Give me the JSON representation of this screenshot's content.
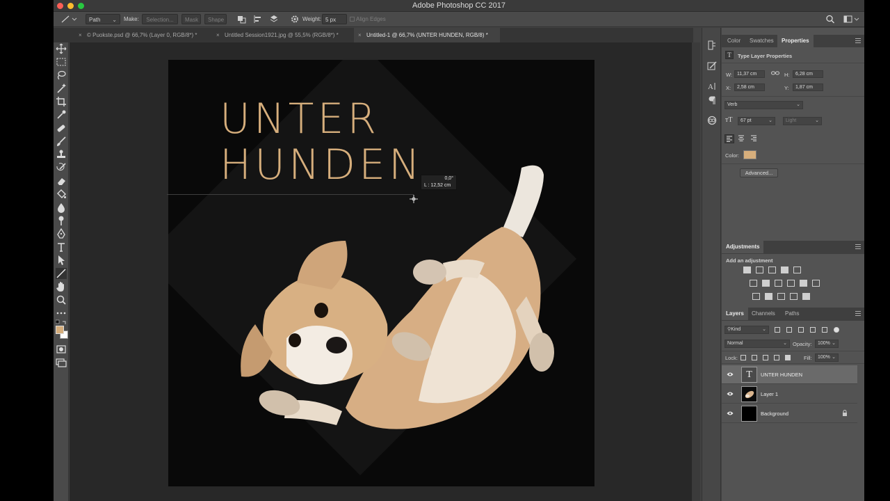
{
  "app": {
    "window_title": "Adobe Photoshop CC 2017"
  },
  "options_bar": {
    "tool_mode": "Path",
    "make_label": "Make:",
    "selection_btn": "Selection...",
    "mask_btn": "Mask",
    "shape_btn": "Shape",
    "weight_label": "Weight:",
    "weight_value": "5 px",
    "align_edges": "Align Edges"
  },
  "tabs": [
    {
      "label": "© Puokste.psd @ 66,7% (Layer 0, RGB/8*) *",
      "active": false
    },
    {
      "label": "Untitled Session1921.jpg @ 55,5% (RGB/8*) *",
      "active": false
    },
    {
      "label": "Untitled-1 @ 66,7% (UNTER HUNDEN, RGB/8) *",
      "active": true
    }
  ],
  "document": {
    "headline_line1": "UNTER",
    "headline_line2": "HUNDEN",
    "text_color": "#d6ae7c",
    "measure_angle": "0,0°",
    "measure_length": "L : 12,52 cm"
  },
  "properties_panel": {
    "tabs": [
      "Color",
      "Swatches",
      "Properties"
    ],
    "active_tab": "Properties",
    "title": "Type Layer Properties",
    "w_label": "W:",
    "w_value": "11,37 cm",
    "h_label": "H:",
    "h_value": "6,28 cm",
    "x_label": "X:",
    "x_value": "2,58 cm",
    "y_label": "Y:",
    "y_value": "1,87 cm",
    "font_family": "Verb",
    "font_size": "67 pt",
    "font_style": "Light",
    "color_label": "Color:",
    "color_swatch": "#d6ae7c",
    "advanced_btn": "Advanced..."
  },
  "adjustments_panel": {
    "title": "Adjustments",
    "subtitle": "Add an adjustment"
  },
  "layers_panel": {
    "tabs": [
      "Layers",
      "Channels",
      "Paths"
    ],
    "active_tab": "Layers",
    "filter_kind": "Kind",
    "blend_mode": "Normal",
    "opacity_label": "Opacity:",
    "opacity_value": "100%",
    "lock_label": "Lock:",
    "fill_label": "Fill:",
    "fill_value": "100%",
    "layers": [
      {
        "name": "UNTER HUNDEN",
        "type": "text",
        "selected": true
      },
      {
        "name": "Layer 1",
        "type": "image",
        "selected": false
      },
      {
        "name": "Background",
        "type": "fill",
        "selected": false,
        "locked": true
      }
    ]
  }
}
